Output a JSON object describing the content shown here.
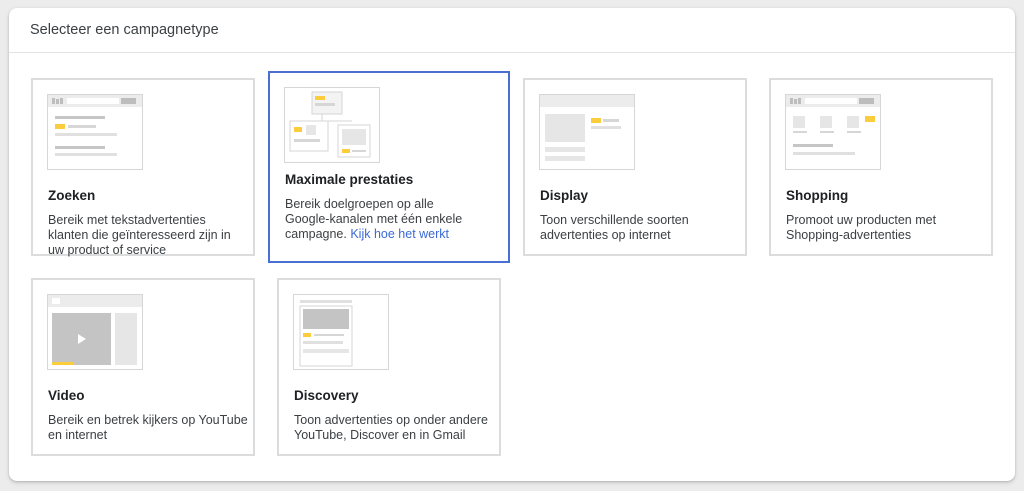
{
  "header": {
    "title": "Selecteer een campagnetype"
  },
  "cards": [
    {
      "title": "Zoeken",
      "description": "Bereik met tekstadvertenties klanten die geïnteresseerd zijn in uw product of service",
      "illustration": "search-ad-illustration"
    },
    {
      "title": "Maximale prestaties",
      "description": "Bereik doelgroepen op alle Google-kanalen met één enkele campagne.",
      "link": "Kijk hoe het werkt",
      "selected": true,
      "illustration": "performance-max-illustration"
    },
    {
      "title": "Display",
      "description": "Toon verschillende soorten advertenties op internet",
      "illustration": "display-ad-illustration"
    },
    {
      "title": "Shopping",
      "description": "Promoot uw producten met Shopping-advertenties",
      "illustration": "shopping-ad-illustration"
    },
    {
      "title": "Video",
      "description": "Bereik en betrek kijkers op YouTube en internet",
      "illustration": "video-ad-illustration"
    },
    {
      "title": "Discovery",
      "description": "Toon advertenties op onder andere YouTube, Discover en in Gmail",
      "illustration": "discovery-ad-illustration"
    }
  ],
  "colors": {
    "accent": "#4a6fd3",
    "highlight": "#fbcc3b",
    "link": "#3b6ad6"
  }
}
